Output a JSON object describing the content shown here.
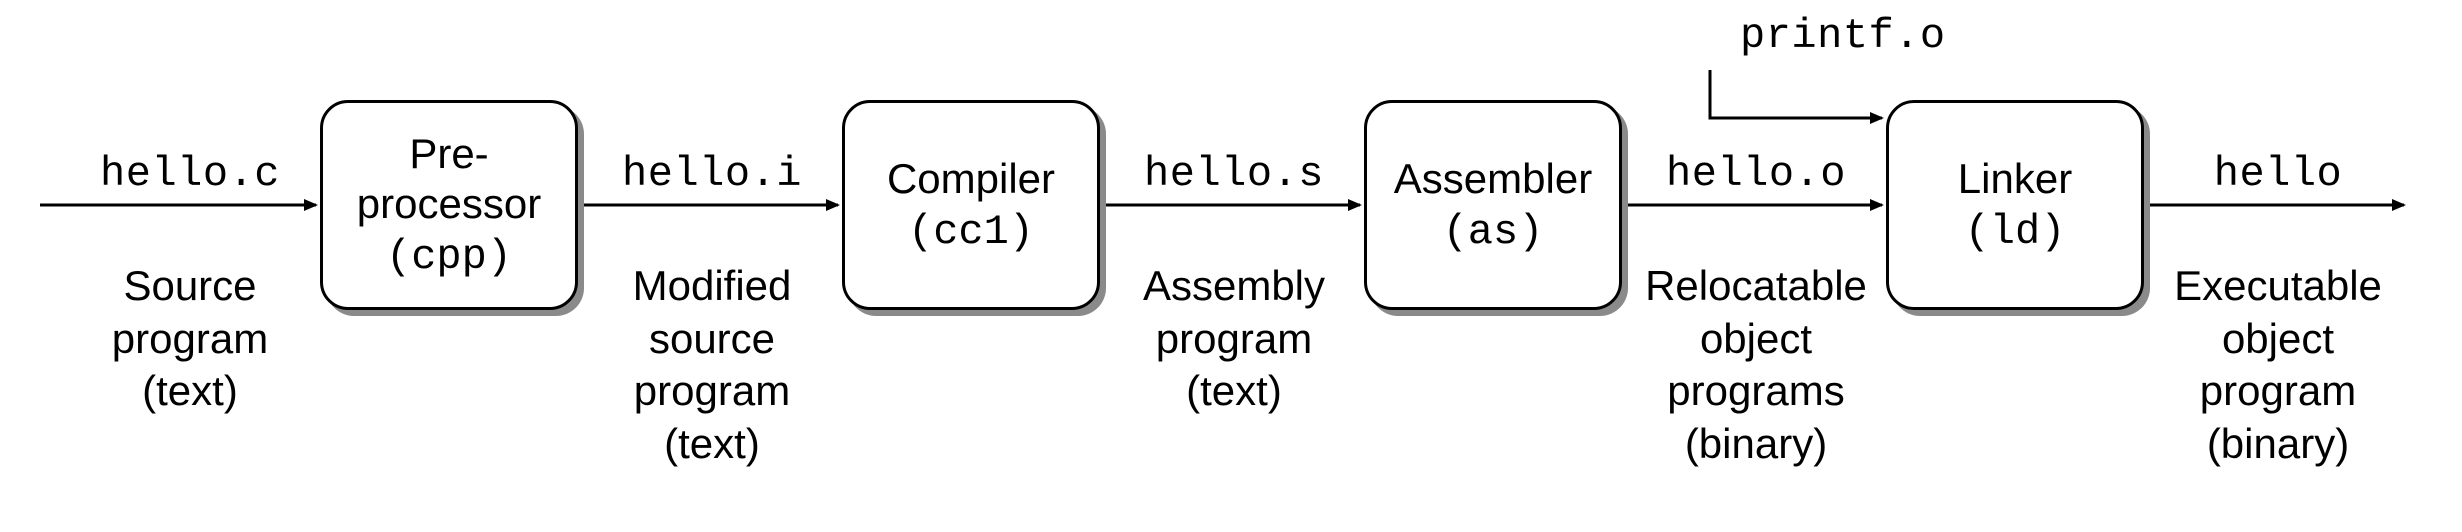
{
  "external_input": {
    "file": "printf.o"
  },
  "arrows": {
    "a0": {
      "file": "hello.c",
      "desc": "Source\nprogram\n(text)"
    },
    "a1": {
      "file": "hello.i",
      "desc": "Modified\nsource\nprogram\n(text)"
    },
    "a2": {
      "file": "hello.s",
      "desc": "Assembly\nprogram\n(text)"
    },
    "a3": {
      "file": "hello.o",
      "desc": "Relocatable\nobject\nprograms\n(binary)"
    },
    "a4": {
      "file": "hello",
      "desc": "Executable\nobject\nprogram\n(binary)"
    }
  },
  "stages": {
    "s0": {
      "title": "Pre-\nprocessor",
      "tool": "(cpp)"
    },
    "s1": {
      "title": "Compiler",
      "tool": "(cc1)"
    },
    "s2": {
      "title": "Assembler",
      "tool": "(as)"
    },
    "s3": {
      "title": "Linker",
      "tool": "(ld)"
    }
  }
}
